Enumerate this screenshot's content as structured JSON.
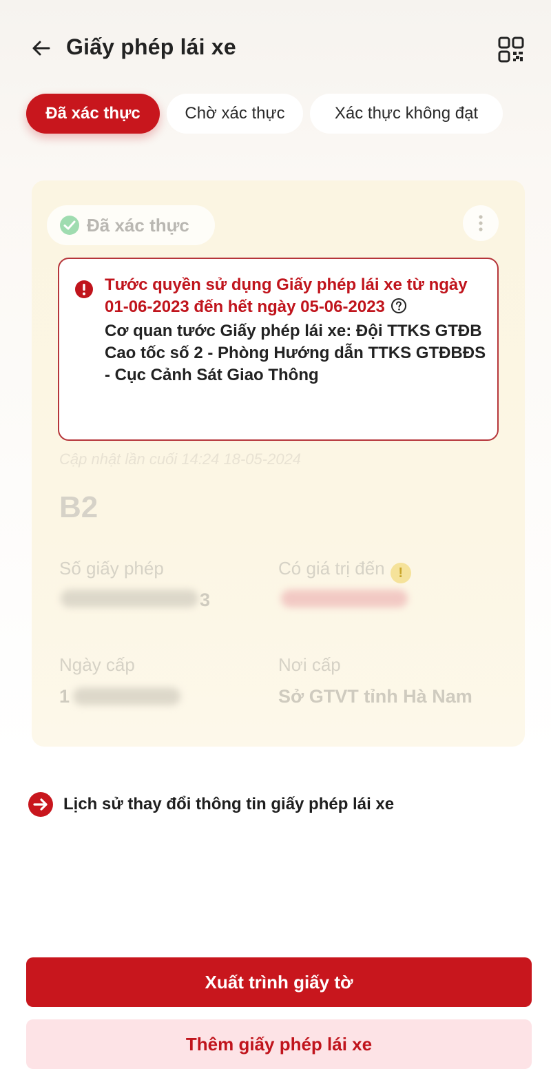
{
  "header": {
    "title": "Giấy phép lái xe",
    "back_icon": "arrow-left-icon",
    "qr_icon": "qr-code-icon"
  },
  "tabs": [
    {
      "label": "Đã xác thực",
      "active": true
    },
    {
      "label": "Chờ xác thực",
      "active": false
    },
    {
      "label": "Xác thực không đạt",
      "active": false
    }
  ],
  "card": {
    "status_label": "Đã xác thực",
    "alert": {
      "title": "Tước quyền sử dụng Giấy phép lái xe từ ngày 01-06-2023 đến hết ngày 05-06-2023",
      "body": "Cơ quan tước Giấy phép lái xe: Đội TTKS GTĐB Cao tốc số 2 - Phòng Hướng dẫn TTKS GTĐBĐS - Cục Cảnh Sát Giao Thông"
    },
    "updated": "Cập nhật lần cuối 14:24 18-05-2024",
    "license_class": "B2",
    "fields": {
      "license_no_label": "Số giấy phép",
      "license_no_suffix": "3",
      "valid_until_label": "Có giá trị đến",
      "issue_date_label": "Ngày cấp",
      "issue_date_prefix": "1",
      "issuer_label": "Nơi cấp",
      "issuer_value": "Sở GTVT tỉnh Hà Nam"
    }
  },
  "history_link": "Lịch sử thay đổi thông tin giấy phép lái xe",
  "buttons": {
    "present": "Xuất trình giấy tờ",
    "add": "Thêm giấy phép lái xe"
  },
  "colors": {
    "brand_red": "#c8161d",
    "alert_border": "#b5353a",
    "secondary_bg": "#fde3e6",
    "card_bg": "#fbf5e2",
    "success_green": "#7fd39a"
  }
}
